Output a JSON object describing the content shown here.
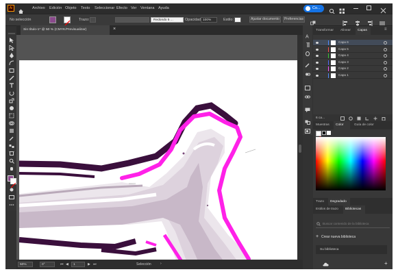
{
  "app": {
    "logo": "Ai",
    "menu": [
      "Archivo",
      "Edición",
      "Objeto",
      "Texto",
      "Seleccionar",
      "Efecto",
      "Ver",
      "Ventana",
      "Ayuda"
    ],
    "user_badge": "Co..."
  },
  "control_bar": {
    "selection_label": "No selección",
    "stroke_label": "Trazo:",
    "brush_label": "Redondo 5 ...",
    "opacity_label": "Opacidad:",
    "opacity_value": "100%",
    "style_label": "Estilo:",
    "document_button": "Ajustar documento",
    "prefs_button": "Preferencias"
  },
  "document": {
    "tab_title": "Sin título-1* @ 50 % (CMYK/Previsualizar)",
    "close": "×"
  },
  "status_bar": {
    "zoom": "50%",
    "rotation": "0°",
    "artboard_num": "1",
    "tool_name": "Selección"
  },
  "layers_panel": {
    "tabs": [
      "Transformar",
      "Alinear",
      "Capas"
    ],
    "active_tab": "Capas",
    "layers": [
      {
        "name": "Capa 6",
        "color": "#4f8bff",
        "selected": true
      },
      {
        "name": "Capa 5",
        "color": "#ff4f4f",
        "selected": false
      },
      {
        "name": "Capa 4",
        "color": "#38c838",
        "selected": false
      },
      {
        "name": "Capa 3",
        "color": "#4f6bff",
        "selected": false
      },
      {
        "name": "Capa 2",
        "color": "#ff4fff",
        "selected": false
      },
      {
        "name": "Capa 1",
        "color": "#4f8bff",
        "selected": false
      }
    ],
    "footer_count": "6 ca..."
  },
  "color_panel": {
    "tabs": [
      "Muestras",
      "Color",
      "Guía de color"
    ],
    "active_tab": "Color"
  },
  "gradient_bar": {
    "tabs": [
      "Trazo",
      "Degradado"
    ]
  },
  "libraries_panel": {
    "tabs": [
      "Estilos de trazo",
      "Bibliotecas"
    ],
    "search_placeholder": "Buscar contenido de la biblioteca",
    "create_button": "Crear nueva biblioteca",
    "library_item": "Su biblioteca"
  },
  "colors": {
    "accent_blue": "#1473e6",
    "art_magenta": "#ff21e8",
    "art_dark": "#3a0f3c",
    "art_mauve": "#c8b8c8"
  }
}
